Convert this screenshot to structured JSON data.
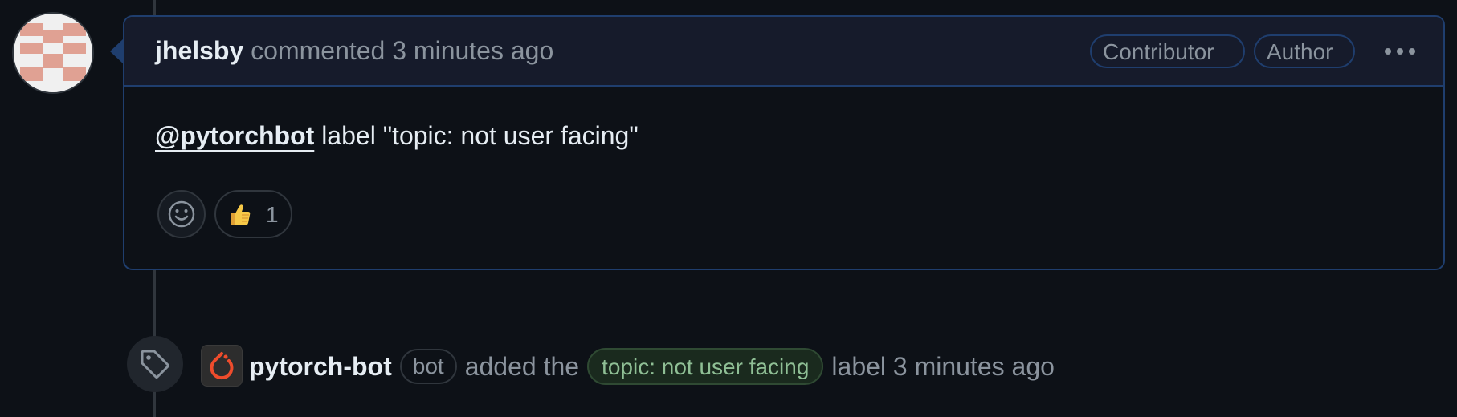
{
  "comment": {
    "author": "jhelsby",
    "action": "commented",
    "timestamp": "3 minutes ago",
    "badges": [
      "Contributor",
      "Author"
    ],
    "menu_icon": "kebab-horizontal-icon",
    "body": {
      "mention": "@pytorchbot",
      "text": " label \"topic: not user facing\""
    },
    "reactions": {
      "add_icon": "smiley-icon",
      "items": [
        {
          "emoji": "thumbs-up",
          "count": "1"
        }
      ]
    }
  },
  "event": {
    "icon": "tag-icon",
    "actor": "pytorch-bot",
    "actor_badge": "bot",
    "action": "added the",
    "label": "topic: not user facing",
    "suffix": "label 3 minutes ago"
  },
  "colors": {
    "background": "#0d1117",
    "header_bg": "#161b2b",
    "border": "#1f3e6e",
    "muted_text": "#8b949e",
    "label_text": "#8fbf95",
    "avatar_pattern": "#e0a193"
  }
}
